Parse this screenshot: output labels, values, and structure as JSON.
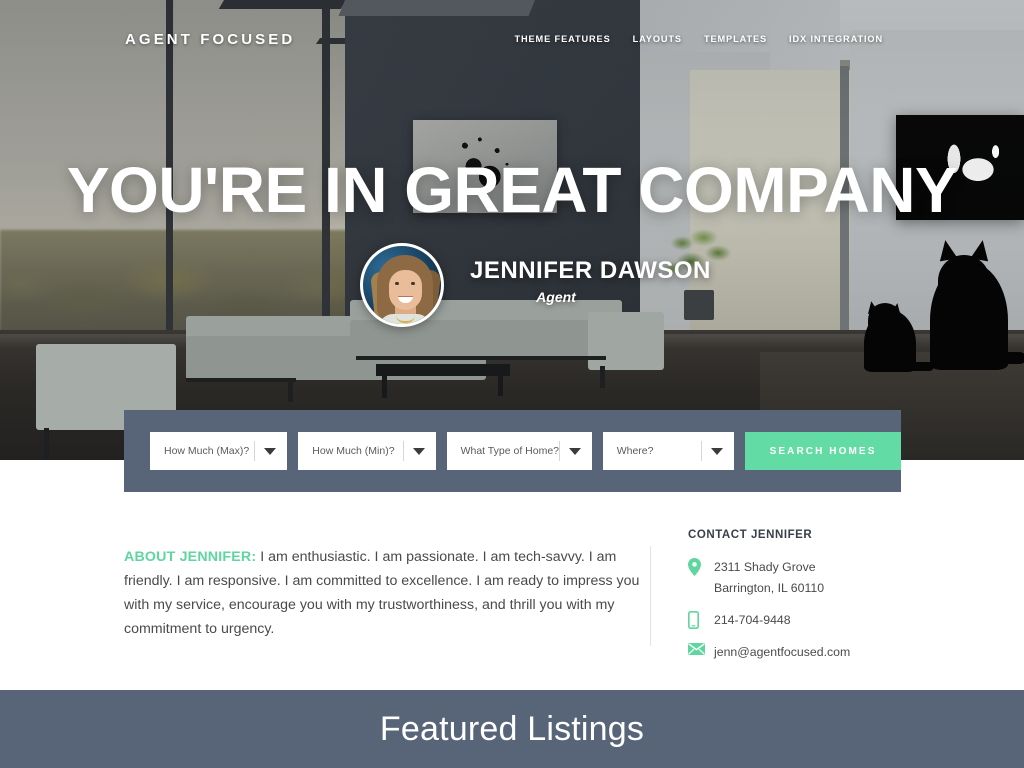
{
  "header": {
    "brand": "AGENT FOCUSED",
    "nav": [
      {
        "label": "THEME FEATURES"
      },
      {
        "label": "LAYOUTS"
      },
      {
        "label": "TEMPLATES"
      },
      {
        "label": "IDX INTEGRATION"
      }
    ]
  },
  "hero": {
    "title": "YOU'RE IN GREAT COMPANY",
    "agent_name": "JENNIFER DAWSON",
    "agent_role": "Agent",
    "avatar_alt": "jennifer-dawson-headshot"
  },
  "search": {
    "fields": [
      {
        "name": "price-max",
        "placeholder": "How Much (Max)?"
      },
      {
        "name": "price-min",
        "placeholder": "How Much (Min)?"
      },
      {
        "name": "home-type",
        "placeholder": "What Type of Home?"
      },
      {
        "name": "location",
        "placeholder": "Where?"
      }
    ],
    "button_label": "SEARCH HOMES"
  },
  "about": {
    "lead": "ABOUT JENNIFER:",
    "body": " I am enthusiastic. I am passionate. I am tech-savvy. I am friendly. I am responsive. I am committed to excellence. I am ready to impress you with my service, encourage you with my trustworthiness, and thrill you with my commitment to urgency."
  },
  "contact": {
    "heading": "CONTACT JENNIFER",
    "address_line1": "2311 Shady Grove",
    "address_line2": "Barrington, IL 60110",
    "phone": "214-704-9448",
    "email": "jenn@agentfocused.com",
    "icons": {
      "address": "map-pin-icon",
      "phone": "mobile-phone-icon",
      "email": "envelope-icon"
    }
  },
  "featured": {
    "title": "Featured Listings"
  },
  "colors": {
    "accent_green": "#63dba5",
    "slate": "#586579",
    "text_dark": "#4a4a4a",
    "heading_dark": "#39404a"
  }
}
